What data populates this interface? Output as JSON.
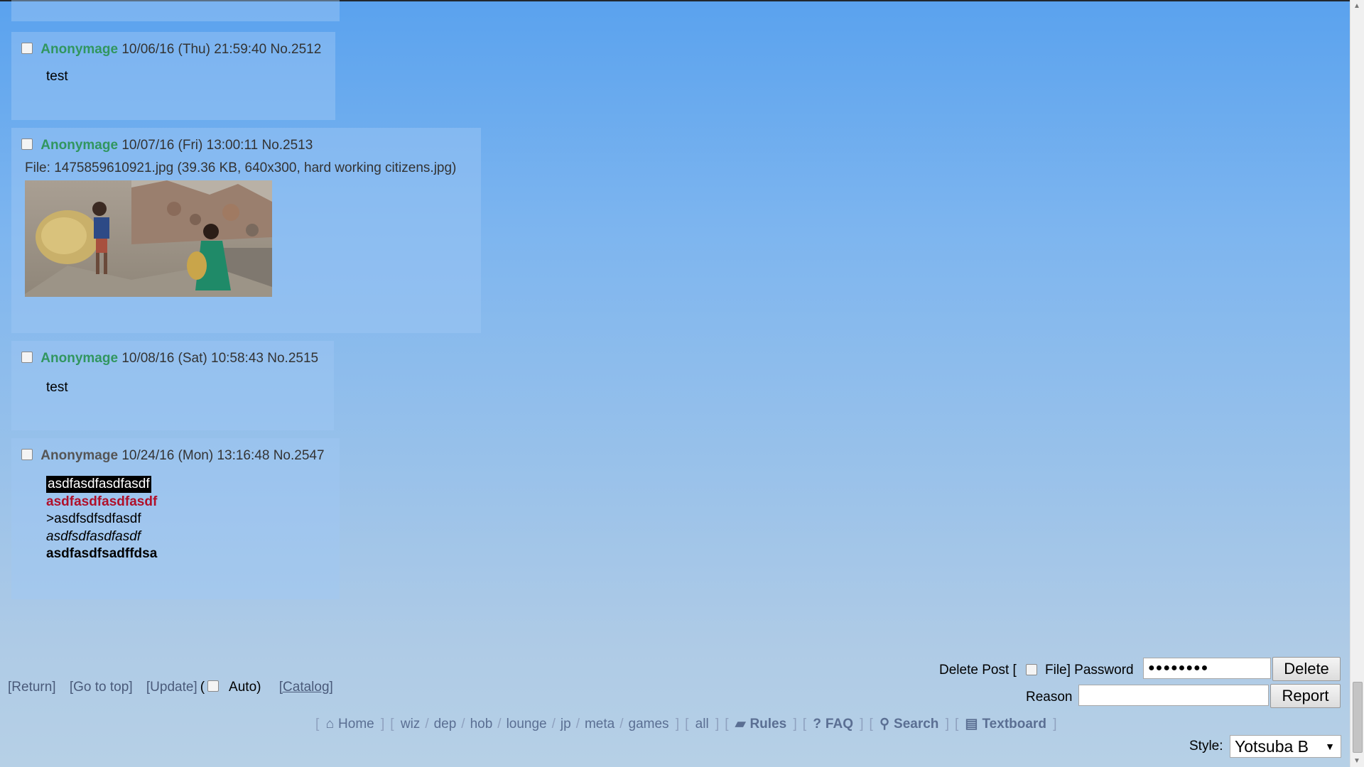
{
  "posts": [
    {
      "name": "Anonymage",
      "datetime": "10/06/16 (Thu) 21:59:40",
      "number": "No.2512",
      "body": "test"
    },
    {
      "name": "Anonymage",
      "datetime": "10/07/16 (Fri) 13:00:11",
      "number": "No.2513",
      "file": {
        "label": "File:",
        "filename": "1475859610921.jpg",
        "meta": "(39.36 KB, 640x300, hard working citizens.jpg)"
      }
    },
    {
      "name": "Anonymage",
      "datetime": "10/08/16 (Sat) 10:58:43",
      "number": "No.2515",
      "body": "test"
    },
    {
      "name": "Anonymage",
      "datetime": "10/24/16 (Mon) 13:16:48",
      "number": "No.2547",
      "lines": {
        "spoiler": "asdfasdfasdfasdf",
        "red": "asdfasdfasdfasdf",
        "greentext": ">asdfsdfsdfasdf",
        "italic": "asdfsdfasdfasdf",
        "bold": "asdfasdfsadffdsa"
      }
    }
  ],
  "bottom_links": {
    "return": "[Return]",
    "top": "[Go to top]",
    "update": "[Update]",
    "paren_open": "(",
    "auto": "Auto)",
    "catalog": "[Catalog]"
  },
  "delete_form": {
    "delete_post_label": "Delete Post [",
    "file_password_label": "File] Password",
    "password_value": "●●●●●●●●",
    "delete_button": "Delete",
    "reason_label": "Reason",
    "reason_value": "",
    "report_button": "Report"
  },
  "nav": {
    "home": "Home",
    "boards": [
      "wiz",
      "dep",
      "hob",
      "lounge",
      "jp",
      "meta",
      "games"
    ],
    "all": "all",
    "rules": "Rules",
    "faq": "FAQ",
    "search": "Search",
    "textboard": "Textboard",
    "bracket_open": "[",
    "bracket_close": "]",
    "separator": "/"
  },
  "style_selector": {
    "label": "Style:",
    "value": "Yotsuba B"
  },
  "colors": {
    "name": "#31965f",
    "red_text": "#b0102a",
    "link": "#5b6f93"
  }
}
